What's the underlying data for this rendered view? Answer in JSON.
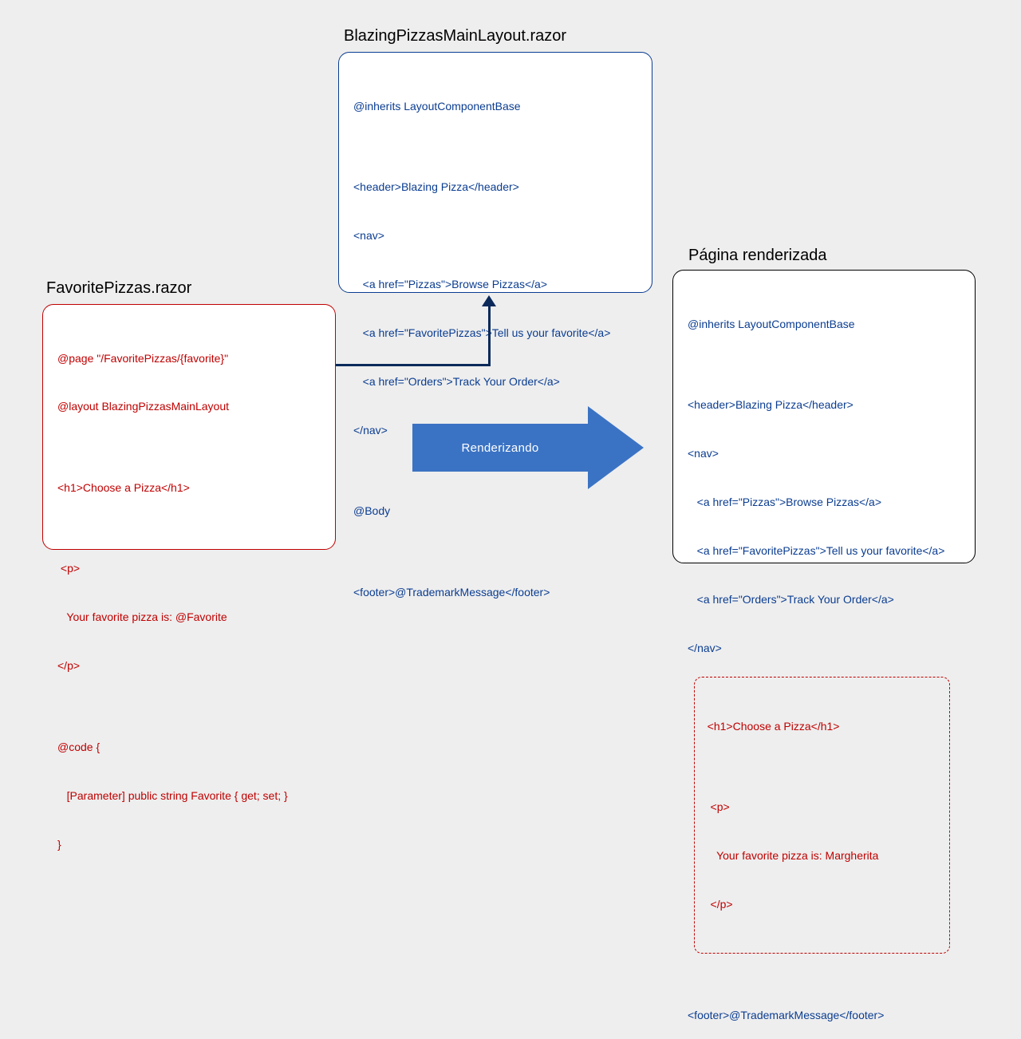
{
  "layout": {
    "title": "BlazingPizzasMainLayout.razor",
    "lines": [
      "@inherits LayoutComponentBase",
      "",
      "<header>Blazing Pizza</header>",
      "<nav>",
      "   <a href=\"Pizzas\">Browse Pizzas</a>",
      "   <a href=\"FavoritePizzas\">Tell us your favorite</a>",
      "   <a href=\"Orders\">Track Your Order</a>",
      "</nav>",
      "",
      "@Body",
      "",
      "<footer>@TrademarkMessage</footer>"
    ]
  },
  "favorite": {
    "title": "FavoritePizzas.razor",
    "lines": [
      "@page \"/FavoritePizzas/{favorite}\"",
      "@layout BlazingPizzasMainLayout",
      "",
      "<h1>Choose a Pizza</h1>",
      "",
      " <p>",
      "   Your favorite pizza is: @Favorite",
      "</p>",
      "",
      "@code {",
      "   [Parameter] public string Favorite { get; set; }",
      "}"
    ]
  },
  "rendered": {
    "title": "Página renderizada",
    "outer_top": [
      "@inherits LayoutComponentBase",
      "",
      "<header>Blazing Pizza</header>",
      "<nav>",
      "   <a href=\"Pizzas\">Browse Pizzas</a>",
      "   <a href=\"FavoritePizzas\">Tell us your favorite</a>",
      "   <a href=\"Orders\">Track Your Order</a>",
      "</nav>"
    ],
    "inner": [
      " <h1>Choose a Pizza</h1>",
      "",
      "  <p>",
      "    Your favorite pizza is: Margherita",
      "  </p>"
    ],
    "outer_bottom": [
      "",
      "<footer>@TrademarkMessage</footer>"
    ]
  },
  "arrow_label": "Renderizando"
}
